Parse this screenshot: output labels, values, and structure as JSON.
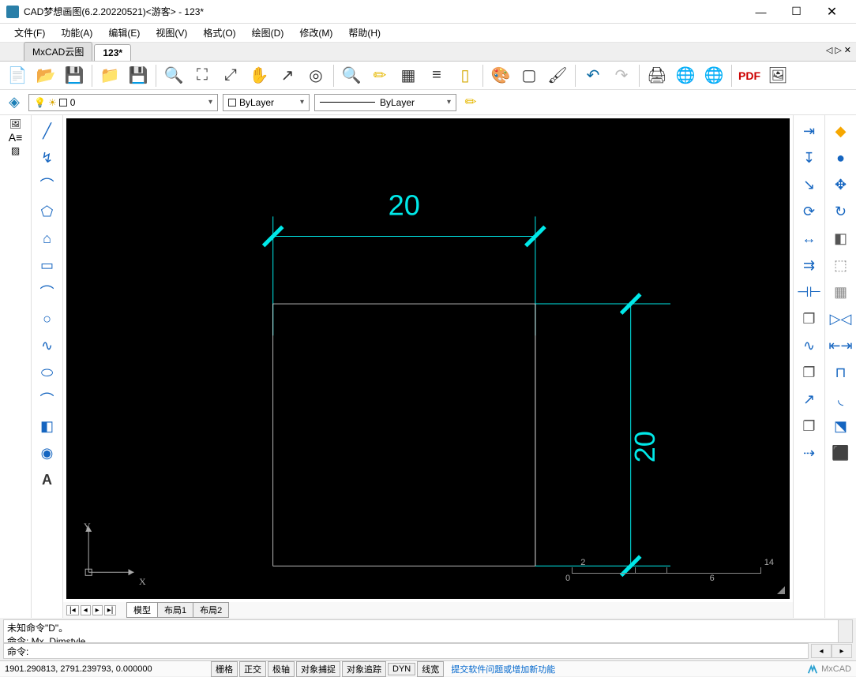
{
  "titlebar": {
    "title": "CAD梦想画图(6.2.20220521)<游客> - 123*"
  },
  "menubar": {
    "items": [
      "文件(F)",
      "功能(A)",
      "编辑(E)",
      "视图(V)",
      "格式(O)",
      "绘图(D)",
      "修改(M)",
      "帮助(H)"
    ]
  },
  "tabs": {
    "items": [
      {
        "label": "MxCAD云图",
        "active": false
      },
      {
        "label": "123*",
        "active": true
      }
    ]
  },
  "layer": {
    "current": "0",
    "bylayer1": "ByLayer",
    "bylayer2": "ByLayer"
  },
  "drawing": {
    "dim_top": "20",
    "dim_right": "20",
    "axis_x": "X",
    "axis_y": "Y"
  },
  "scale": {
    "t0": "0",
    "t1": "2",
    "t2": "6",
    "t3": "14"
  },
  "bottom_tabs": {
    "items": [
      "模型",
      "布局1",
      "布局2"
    ]
  },
  "cmd": {
    "hist1": "未知命令\"D\"。",
    "hist2": "命令: Mx_Dimstyle",
    "prompt": "命令:"
  },
  "status": {
    "coords": "1901.290813, 2791.239793, 0.000000",
    "btns": [
      "栅格",
      "正交",
      "极轴",
      "对象捕捉",
      "对象追踪",
      "DYN",
      "线宽"
    ],
    "link": "提交软件问题或增加新功能",
    "brand": "MxCAD"
  }
}
